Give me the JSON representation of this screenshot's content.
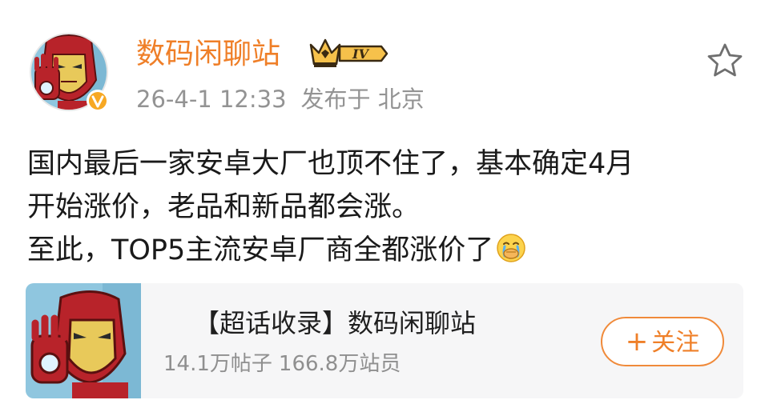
{
  "post": {
    "author": {
      "name": "数码闲聊站",
      "level": "IV",
      "verified_icon": "verified-v-badge"
    },
    "time": "26-4-1 12:33",
    "location": "发布于 北京",
    "favorite_icon": "star-outline-icon",
    "lines": [
      "国内最后一家安卓大厂也顶不住了，基本确定4月",
      "开始涨价，老品和新品都会涨。",
      "至此，TOP5主流安卓厂商全都涨价了"
    ],
    "emoji": "crying-face-emoji"
  },
  "card": {
    "title": "【超话收录】数码闲聊站",
    "posts": "14.1万帖子",
    "members": "166.8万站员",
    "follow_plus": "+",
    "follow_label": "关注"
  },
  "colors": {
    "accent": "#ef7f28",
    "muted": "#939393",
    "card_bg": "#f6f6f7"
  }
}
